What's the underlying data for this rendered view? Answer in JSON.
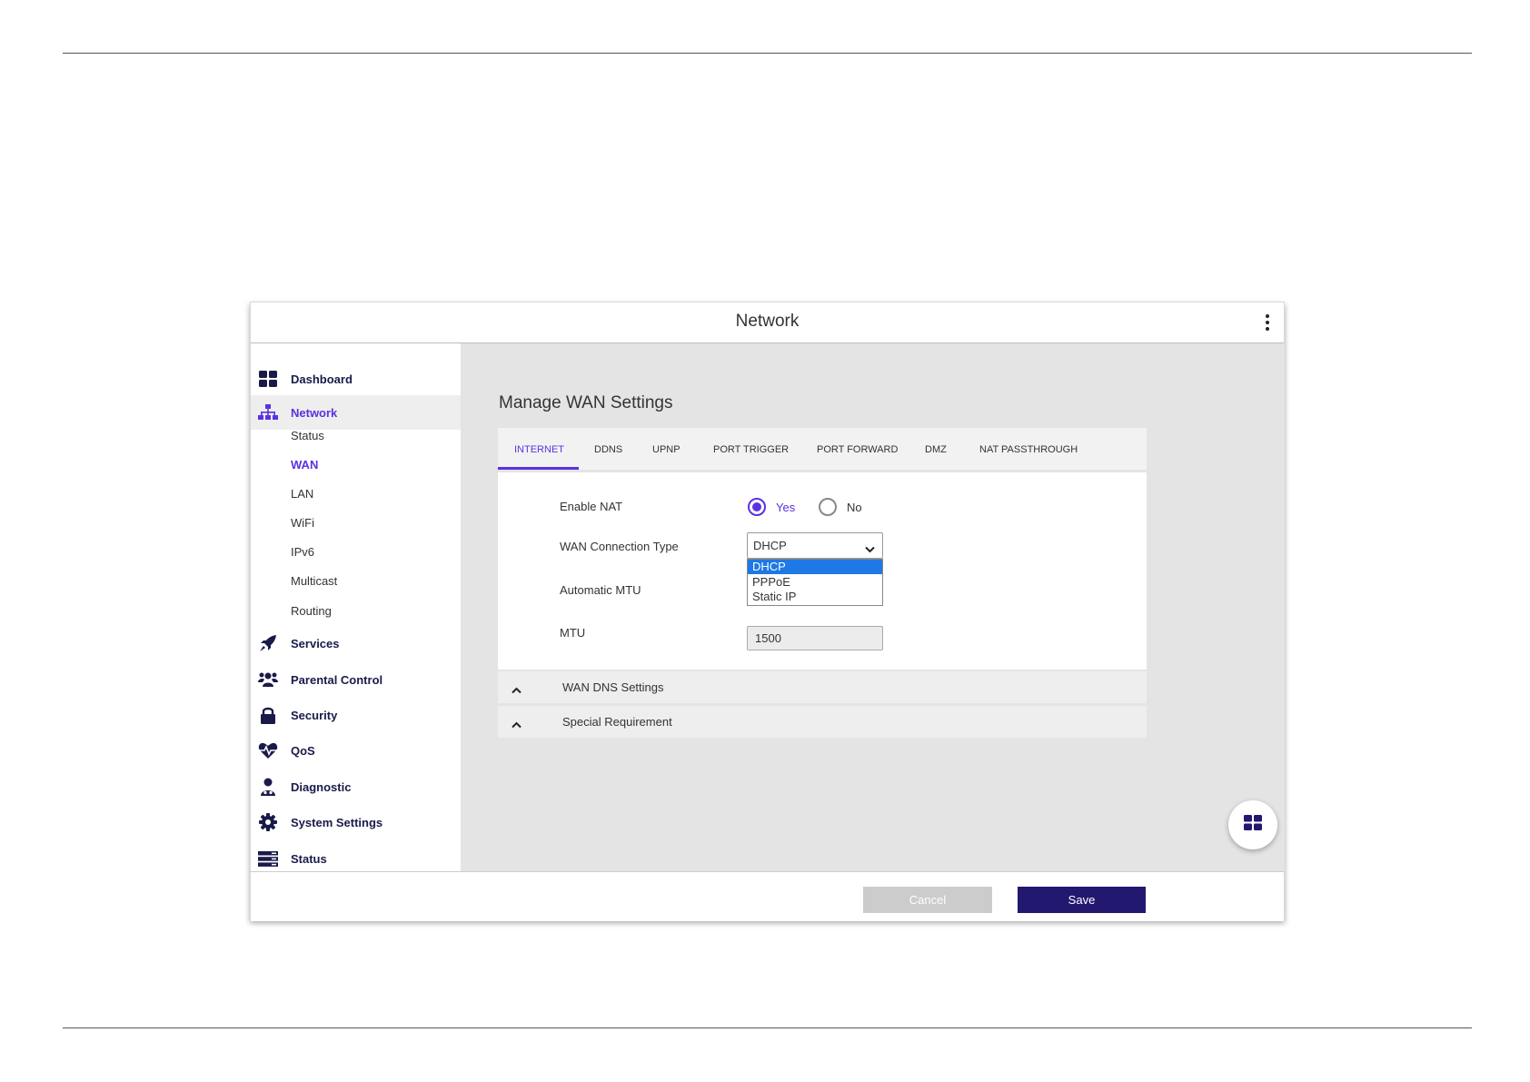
{
  "appbar": {
    "title": "Network"
  },
  "sidebar": {
    "items": [
      {
        "label": "Dashboard",
        "icon": "dashboard-icon"
      },
      {
        "label": "Network",
        "icon": "network-icon",
        "active": true
      },
      {
        "label": "Services",
        "icon": "rocket-icon"
      },
      {
        "label": "Parental Control",
        "icon": "users-icon"
      },
      {
        "label": "Security",
        "icon": "lock-icon"
      },
      {
        "label": "QoS",
        "icon": "heartbeat-icon"
      },
      {
        "label": "Diagnostic",
        "icon": "doctor-icon"
      },
      {
        "label": "System Settings",
        "icon": "gear-icon"
      },
      {
        "label": "Status",
        "icon": "server-icon"
      }
    ],
    "network_sub": [
      "Status",
      "WAN",
      "LAN",
      "WiFi",
      "IPv6",
      "Multicast",
      "Routing"
    ],
    "active_sub": "WAN"
  },
  "main": {
    "page_title": "Manage WAN Settings",
    "tabs": [
      "INTERNET",
      "DDNS",
      "UPNP",
      "PORT TRIGGER",
      "PORT FORWARD",
      "DMZ",
      "NAT PASSTHROUGH"
    ],
    "active_tab": "INTERNET",
    "form": {
      "enable_nat_label": "Enable NAT",
      "yes_label": "Yes",
      "no_label": "No",
      "nat_value": "Yes",
      "wan_type_label": "WAN Connection Type",
      "wan_type_value": "DHCP",
      "wan_type_options": [
        "DHCP",
        "PPPoE",
        "Static IP"
      ],
      "auto_mtu_label": "Automatic MTU",
      "mtu_label": "MTU",
      "mtu_value": "1500"
    },
    "accordions": [
      "WAN DNS Settings",
      "Special Requirement"
    ]
  },
  "footer": {
    "cancel_label": "Cancel",
    "save_label": "Save"
  },
  "colors": {
    "accent": "#5b32e0",
    "navy": "#231870",
    "highlight": "#1e78e6"
  }
}
